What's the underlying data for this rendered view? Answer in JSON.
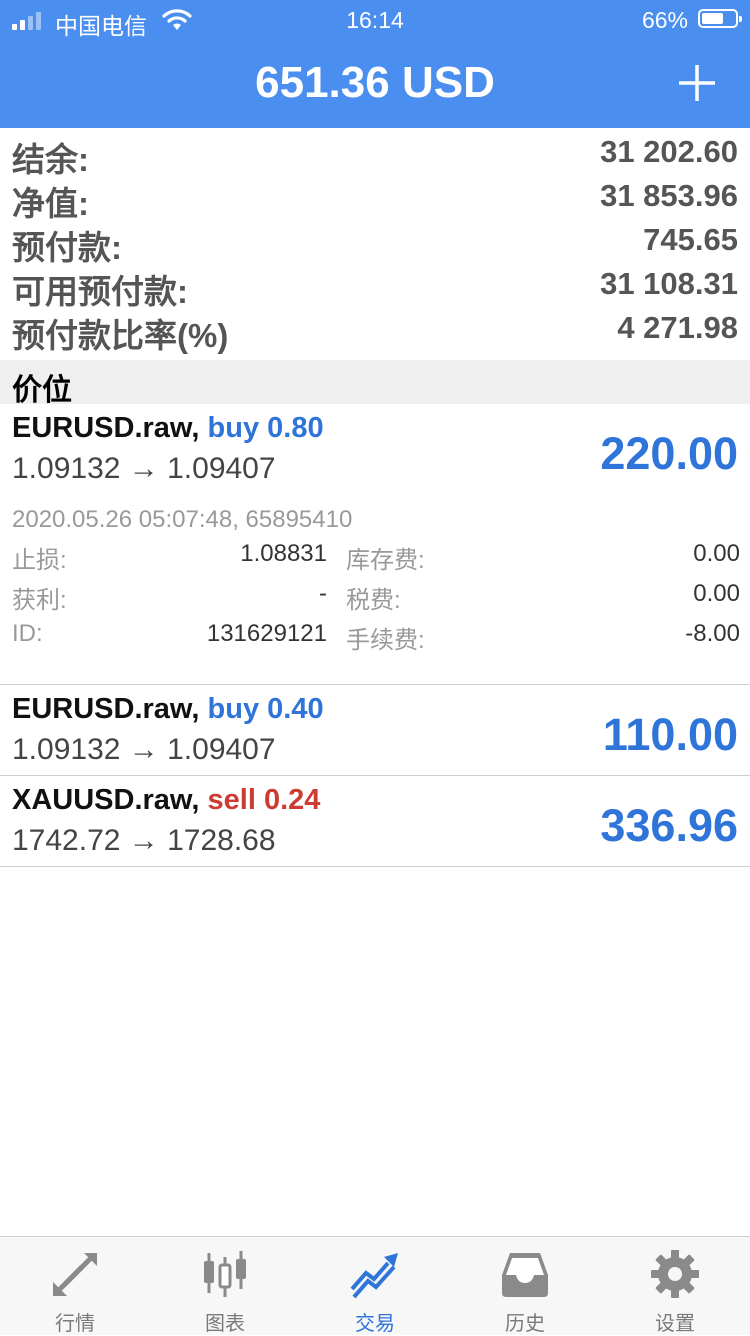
{
  "status_bar": {
    "carrier": "中国电信",
    "time": "16:14",
    "battery": "66%",
    "battery_level": 0.66
  },
  "header": {
    "title": "651.36 USD"
  },
  "summary": [
    {
      "label": "结余:",
      "value": "31 202.60"
    },
    {
      "label": "净值:",
      "value": "31 853.96"
    },
    {
      "label": "预付款:",
      "value": "745.65"
    },
    {
      "label": "可用预付款:",
      "value": "31 108.31"
    },
    {
      "label": "预付款比率(%)",
      "value": "4 271.98"
    }
  ],
  "section": {
    "title": "价位"
  },
  "positions": [
    {
      "symbol": "EURUSD.raw,",
      "side": "buy 0.80",
      "prices": "1.09132 → 1.09407",
      "profit": "220.00",
      "details": {
        "open_info": "2020.05.26 05:07:48, 65895410",
        "sl_label": "止损:",
        "sl_value": "1.08831",
        "swap_label": "库存费:",
        "swap_value": "0.00",
        "tp_label": "获利:",
        "tp_value": "-",
        "tax_label": "税费:",
        "tax_value": "0.00",
        "id_label": "ID:",
        "id_value": "131629121",
        "commission_label": "手续费:",
        "commission_value": "-8.00"
      }
    },
    {
      "symbol": "EURUSD.raw,",
      "side": "buy 0.40",
      "prices": "1.09132 → 1.09407",
      "profit": "110.00"
    },
    {
      "symbol": "XAUUSD.raw,",
      "side": "sell 0.24",
      "prices": "1742.72 → 1728.68",
      "profit": "336.96"
    }
  ],
  "tabs": [
    {
      "label": "行情",
      "icon": "quotes-arrows-icon"
    },
    {
      "label": "图表",
      "icon": "candlestick-chart-icon"
    },
    {
      "label": "交易",
      "icon": "trade-trend-icon",
      "active": true
    },
    {
      "label": "历史",
      "icon": "history-inbox-icon"
    },
    {
      "label": "设置",
      "icon": "settings-gear-icon"
    }
  ],
  "colors": {
    "header_bg": "#4a8ef0",
    "buy": "#2f74d8",
    "sell": "#cc3c32",
    "profit": "#2f74d8"
  }
}
